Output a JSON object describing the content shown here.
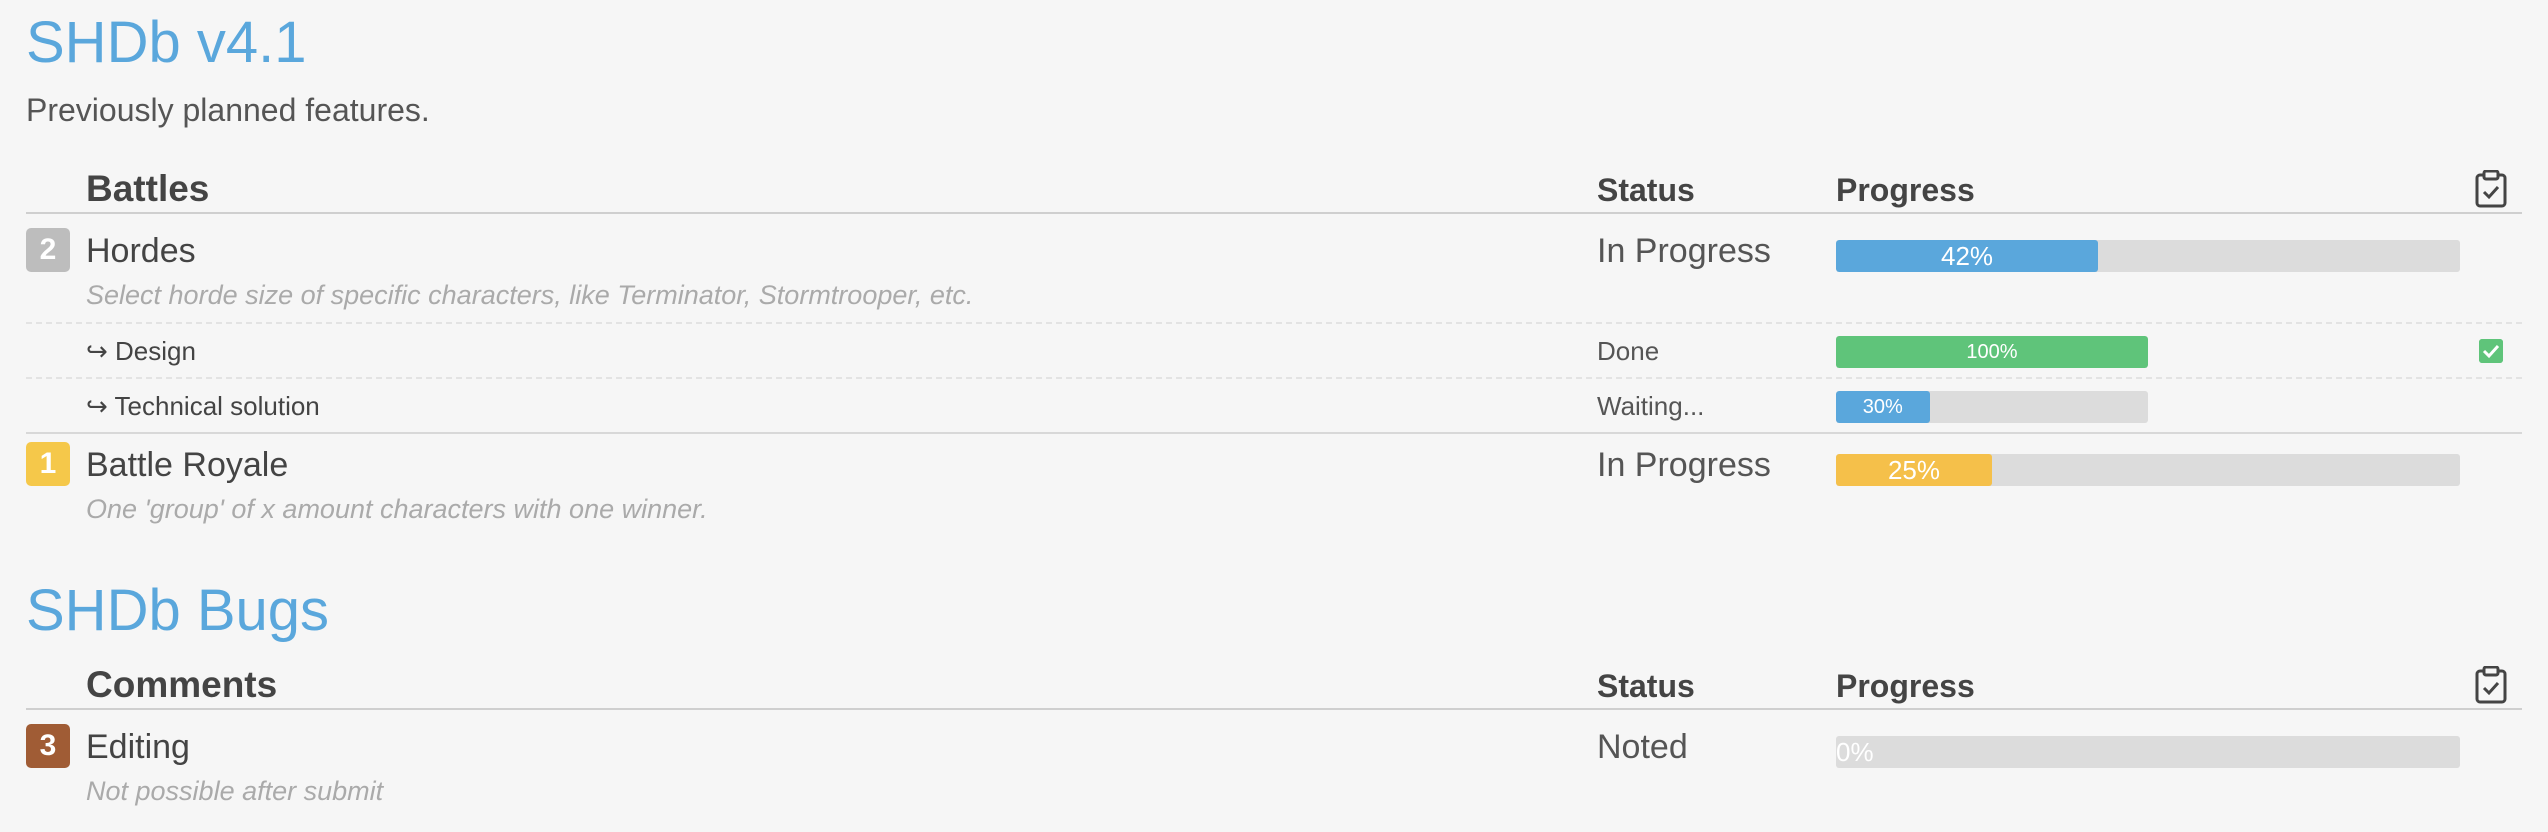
{
  "section1": {
    "title": "SHDb v4.1",
    "subtitle": "Previously planned features.",
    "header": {
      "name": "Battles",
      "status": "Status",
      "progress": "Progress",
      "icon": "clipboard-check-icon"
    },
    "items": [
      {
        "badge": "2",
        "badge_color": "#bdbdbd",
        "title": "Hordes",
        "description": "Select horde size of specific characters, like Terminator, Stormtrooper, etc.",
        "status": "In Progress",
        "progress": 42,
        "progress_label": "42%",
        "progress_color": "#5aa7dc",
        "subitems": [
          {
            "title": "↪ Design",
            "status": "Done",
            "progress": 100,
            "progress_label": "100%",
            "progress_color": "#5fc47a",
            "checked": true
          },
          {
            "title": "↪ Technical solution",
            "status": "Waiting...",
            "progress": 30,
            "progress_label": "30%",
            "progress_color": "#5aa7dc",
            "checked": false
          }
        ]
      },
      {
        "badge": "1",
        "badge_color": "#f5c84a",
        "title": "Battle Royale",
        "description": "One 'group' of x amount characters with one winner.",
        "status": "In Progress",
        "progress": 25,
        "progress_label": "25%",
        "progress_color": "#f5c04a"
      }
    ]
  },
  "section2": {
    "title": "SHDb Bugs",
    "header": {
      "name": "Comments",
      "status": "Status",
      "progress": "Progress",
      "icon": "clipboard-check-icon"
    },
    "items": [
      {
        "badge": "3",
        "badge_color": "#a05c35",
        "title": "Editing",
        "description": "Not possible after submit",
        "status": "Noted",
        "progress": 0,
        "progress_label": "0%",
        "progress_color": "#dcdcdc"
      }
    ]
  }
}
